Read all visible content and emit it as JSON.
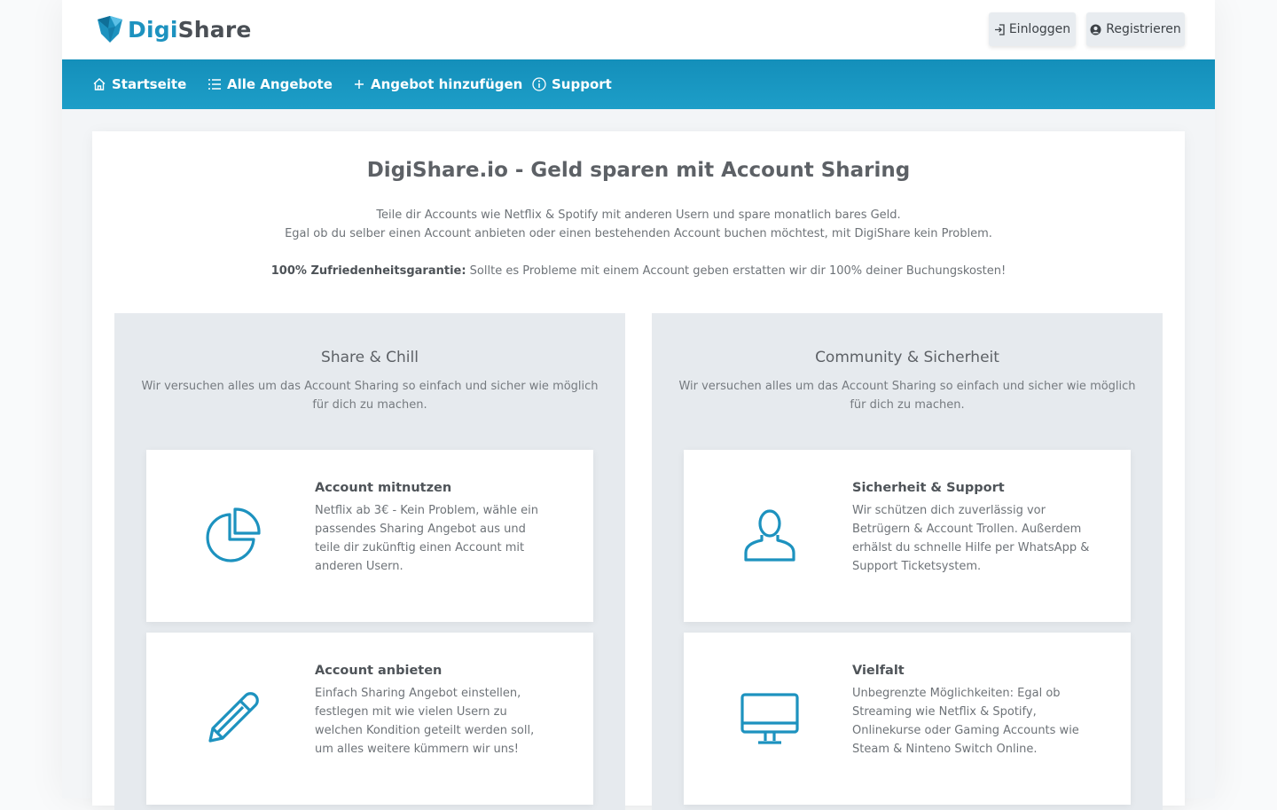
{
  "brand": {
    "name_part1": "Digi",
    "name_part2": "Share"
  },
  "auth": {
    "login_label": "Einloggen",
    "register_label": "Registrieren"
  },
  "nav": {
    "home": "Startseite",
    "all_offers": "Alle Angebote",
    "add_offer": "Angebot hinzufügen",
    "support": "Support"
  },
  "hero": {
    "title": "DigiShare.io - Geld sparen mit Account Sharing",
    "line1": "Teile dir Accounts wie Netflix & Spotify mit anderen Usern und spare monatlich bares Geld.",
    "line2": "Egal ob du selber einen Account anbieten oder einen bestehenden Account buchen möchtest, mit DigiShare kein Problem.",
    "guarantee_label": "100% Zufriedenheitsgarantie:",
    "guarantee_text": " Sollte es Probleme mit einem Account geben erstatten wir dir 100% deiner Buchungskosten!"
  },
  "columns": [
    {
      "title": "Share & Chill",
      "subtitle_line1": "Wir versuchen alles um das Account Sharing so einfach und sicher wie möglich",
      "subtitle_line2": "für dich zu machen.",
      "cards": [
        {
          "icon": "pie-chart-icon",
          "title": "Account mitnutzen",
          "text": "Netflix ab 3€ - Kein Problem, wähle ein passendes Sharing Angebot aus und teile dir zukünftig einen Account mit anderen Usern."
        },
        {
          "icon": "pencil-icon",
          "title": "Account anbieten",
          "text": "Einfach Sharing Angebot einstellen, festlegen mit wie vielen Usern zu welchen Kondition geteilt werden soll, um alles weitere kümmern wir uns!"
        }
      ]
    },
    {
      "title": "Community & Sicherheit",
      "subtitle_line1": "Wir versuchen alles um das Account Sharing so einfach und sicher wie möglich",
      "subtitle_line2": "für dich zu machen.",
      "cards": [
        {
          "icon": "user-icon",
          "title": "Sicherheit & Support",
          "text": "Wir schützen dich zuverlässig vor Betrügern & Account Trollen. Außerdem erhälst du schnelle Hilfe per WhatsApp & Support Ticketsystem."
        },
        {
          "icon": "monitor-icon",
          "title": "Vielfalt",
          "text": "Unbegrenzte Möglichkeiten: Egal ob Streaming wie Netflix & Spotify, Onlinekurse oder Gaming Accounts wie Steam & Ninteno Switch Online."
        }
      ]
    }
  ],
  "colors": {
    "accent": "#1d92bf",
    "nav_bg": "#1796c1",
    "panel_bg": "#e6eaee"
  }
}
